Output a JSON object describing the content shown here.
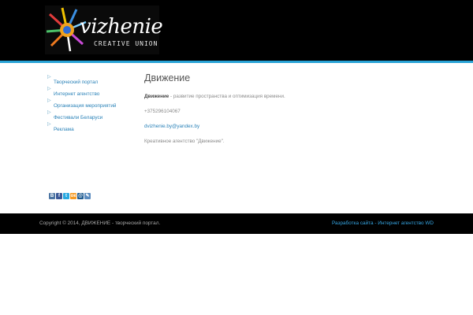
{
  "header": {
    "logo": {
      "word": "vizhenie",
      "subtitle": "CREATIVE UNION",
      "icon": "pencil-sunburst-logo-icon"
    }
  },
  "sidebar": {
    "arrow_icon": "▷",
    "items": [
      {
        "label": "Творческий портал"
      },
      {
        "label": "Интернет агентство"
      },
      {
        "label": "Организация мероприятий"
      },
      {
        "label": "Фестивали Беларуси"
      },
      {
        "label": "Реклама"
      }
    ]
  },
  "main": {
    "title": "Движение",
    "lead_bold": "Движение",
    "lead_rest": " - развитие пространства и оптимизация времени.",
    "phone": "+375296104067",
    "email": "dvizhenie.by@yandex.by",
    "note": "Креативное агентство \"Движение\"."
  },
  "share": {
    "buttons": [
      {
        "icon": "vk-icon",
        "glyph": "B",
        "color": "#4c75a3"
      },
      {
        "icon": "facebook-icon",
        "glyph": "f",
        "color": "#3b5998"
      },
      {
        "icon": "twitter-icon",
        "glyph": "t",
        "color": "#29a9e1"
      },
      {
        "icon": "odnoklassniki-icon",
        "glyph": "ок",
        "color": "#f59a23"
      },
      {
        "icon": "mailru-icon",
        "glyph": "@",
        "color": "#1f5b8f"
      },
      {
        "icon": "livejournal-icon",
        "glyph": "✎",
        "color": "#5b8cbf"
      }
    ]
  },
  "footer": {
    "copyright": "Copyright © 2014, ДВИЖЕНИЕ - творческий портал.",
    "dev_link": "Разработка сайта - Интернет агентство WD"
  },
  "colors": {
    "header_bg": "#000000",
    "accent_line": "#29a3d6",
    "link": "#2a82b8",
    "footer_link": "#36a6e3"
  }
}
